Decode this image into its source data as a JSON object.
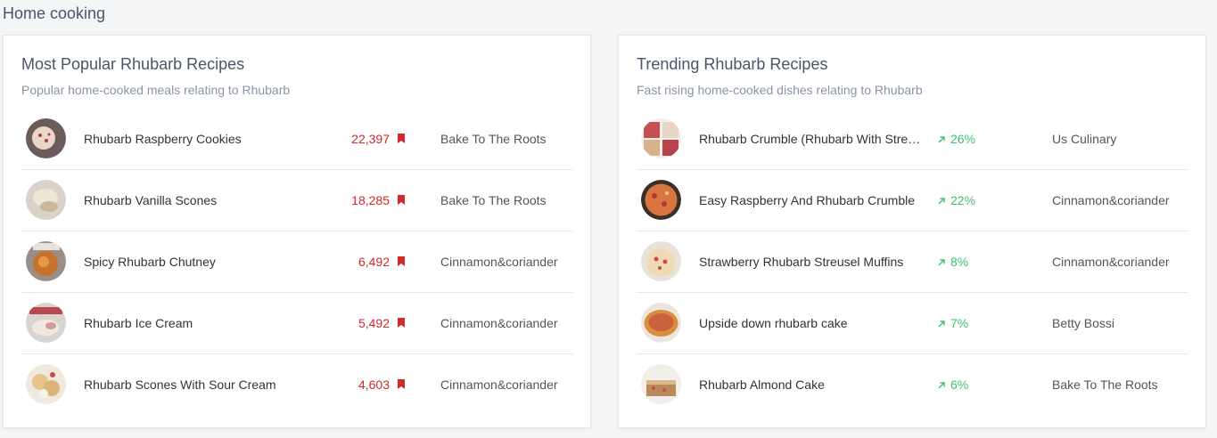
{
  "section_title": "Home cooking",
  "colors": {
    "count_red": "#d0292e",
    "trend_green": "#3fbf6f"
  },
  "popular": {
    "title": "Most Popular Rhubarb Recipes",
    "subtitle": "Popular home-cooked meals relating to Rhubarb",
    "items": [
      {
        "name": "Rhubarb Raspberry Cookies",
        "count": "22,397",
        "source": "Bake To The Roots",
        "icon": "bookmark-icon"
      },
      {
        "name": "Rhubarb Vanilla Scones",
        "count": "18,285",
        "source": "Bake To The Roots",
        "icon": "bookmark-icon"
      },
      {
        "name": "Spicy Rhubarb Chutney",
        "count": "6,492",
        "source": "Cinnamon&coriander",
        "icon": "bookmark-icon"
      },
      {
        "name": "Rhubarb Ice Cream",
        "count": "5,492",
        "source": "Cinnamon&coriander",
        "icon": "bookmark-icon"
      },
      {
        "name": "Rhubarb Scones With Sour Cream",
        "count": "4,603",
        "source": "Cinnamon&coriander",
        "icon": "bookmark-icon"
      }
    ]
  },
  "trending": {
    "title": "Trending Rhubarb Recipes",
    "subtitle": "Fast rising home-cooked dishes relating to Rhubarb",
    "items": [
      {
        "name": "Rhubarb Crumble (Rhubarb With Streusel)",
        "trend": "26%",
        "source": "Us Culinary",
        "icon": "trend-up-icon"
      },
      {
        "name": "Easy Raspberry And Rhubarb Crumble",
        "trend": "22%",
        "source": "Cinnamon&coriander",
        "icon": "trend-up-icon"
      },
      {
        "name": "Strawberry Rhubarb Streusel Muffins",
        "trend": "8%",
        "source": "Cinnamon&coriander",
        "icon": "trend-up-icon"
      },
      {
        "name": "Upside down rhubarb cake",
        "trend": "7%",
        "source": "Betty Bossi",
        "icon": "trend-up-icon"
      },
      {
        "name": "Rhubarb Almond Cake",
        "trend": "6%",
        "source": "Bake To The Roots",
        "icon": "trend-up-icon"
      }
    ]
  }
}
